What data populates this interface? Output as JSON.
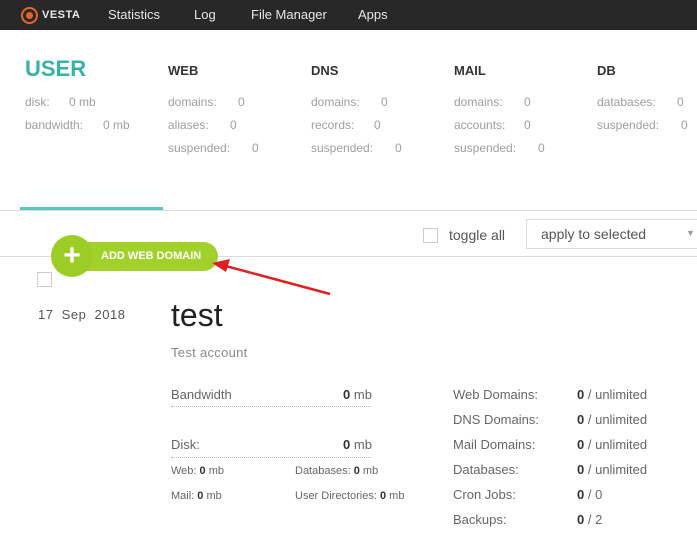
{
  "nav": {
    "logo": "VESTA",
    "items": [
      "Statistics",
      "Log",
      "File Manager",
      "Apps"
    ]
  },
  "summary": {
    "user": {
      "title": "USER",
      "disk_label": "disk:",
      "disk_value": "0 mb",
      "bandwidth_label": "bandwidth:",
      "bandwidth_value": "0 mb"
    },
    "web": {
      "title": "WEB",
      "rows": [
        {
          "label": "domains:",
          "value": "0"
        },
        {
          "label": "aliases:",
          "value": "0"
        },
        {
          "label": "suspended:",
          "value": "0"
        }
      ]
    },
    "dns": {
      "title": "DNS",
      "rows": [
        {
          "label": "domains:",
          "value": "0"
        },
        {
          "label": "records:",
          "value": "0"
        },
        {
          "label": "suspended:",
          "value": "0"
        }
      ]
    },
    "mail": {
      "title": "MAIL",
      "rows": [
        {
          "label": "domains:",
          "value": "0"
        },
        {
          "label": "accounts:",
          "value": "0"
        },
        {
          "label": "suspended:",
          "value": "0"
        }
      ]
    },
    "db": {
      "title": "DB",
      "rows": [
        {
          "label": "databases:",
          "value": "0"
        },
        {
          "label": "suspended:",
          "value": "0"
        }
      ]
    }
  },
  "toolbar": {
    "add_label": "ADD WEB DOMAIN",
    "add_symbol": "+",
    "toggle_all": "toggle all",
    "apply_select": "apply to selected"
  },
  "entry": {
    "date": "17  Sep  2018",
    "name": "test",
    "description": "Test account",
    "bandwidth_label": "Bandwidth",
    "bandwidth_value": "0",
    "bandwidth_unit": "mb",
    "disk_label": "Disk:",
    "disk_value": "0",
    "disk_unit": "mb",
    "web_label": "Web:",
    "web_value": "0",
    "web_unit": "mb",
    "databases_label": "Databases:",
    "databases_value": "0",
    "databases_unit": "mb",
    "mail_label": "Mail:",
    "mail_value": "0",
    "mail_unit": "mb",
    "userdirs_label": "User Directories:",
    "userdirs_value": "0",
    "userdirs_unit": "mb",
    "right_stats": [
      {
        "label": "Web Domains:",
        "value": "0",
        "limit": "/ unlimited"
      },
      {
        "label": "DNS Domains:",
        "value": "0",
        "limit": "/ unlimited"
      },
      {
        "label": "Mail Domains:",
        "value": "0",
        "limit": "/ unlimited"
      },
      {
        "label": "Databases:",
        "value": "0",
        "limit": "/ unlimited"
      },
      {
        "label": "Cron Jobs:",
        "value": "0",
        "limit": "/ 0"
      },
      {
        "label": "Backups:",
        "value": "0",
        "limit": "/ 2"
      }
    ]
  },
  "colors": {
    "accent": "#36b2a6",
    "add_button": "#a3d12c",
    "arrow": "#e02020",
    "topbar": "#282828"
  }
}
